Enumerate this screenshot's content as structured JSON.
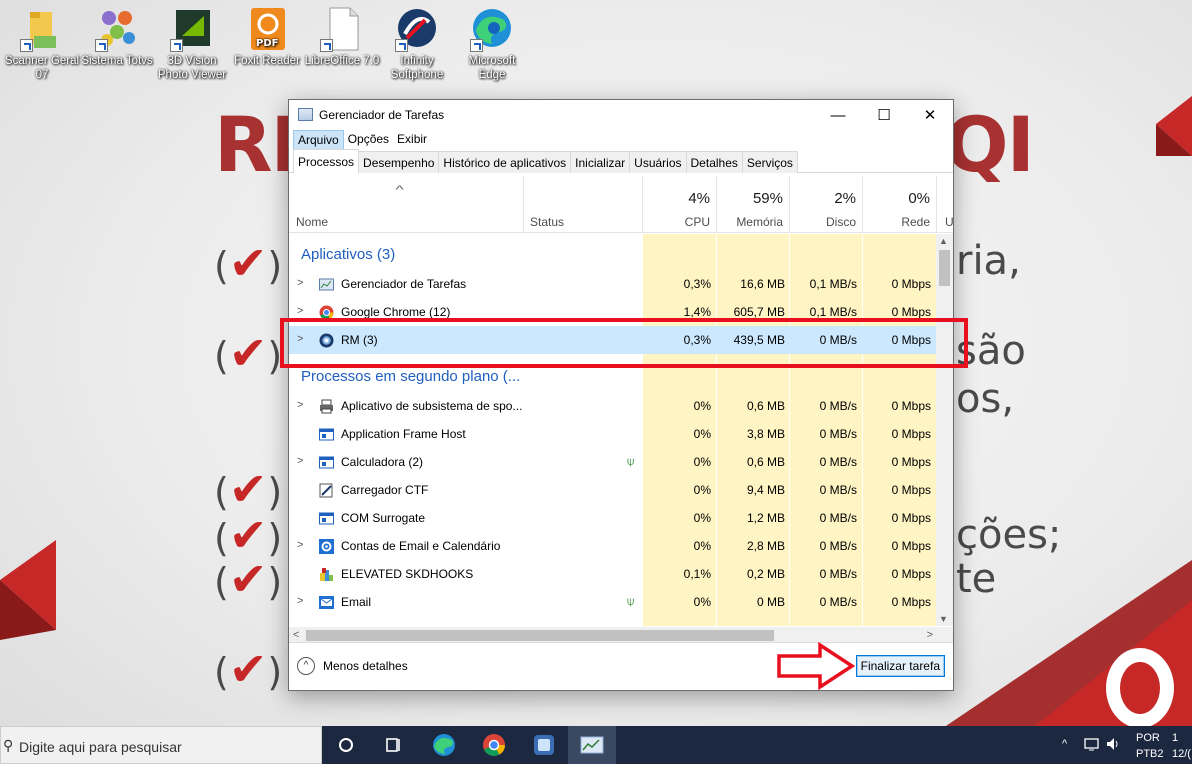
{
  "desktop": {
    "icons": [
      {
        "label": "Scanner Geral 07"
      },
      {
        "label": "Sistema Totvs"
      },
      {
        "label": "3D Vision Photo Viewer"
      },
      {
        "label": "Foxit Reader"
      },
      {
        "label": "LibreOffice 7.0"
      },
      {
        "label": "Infinity Softphone"
      },
      {
        "label": "Microsoft Edge"
      }
    ],
    "wallpaper": {
      "left_big": "RE",
      "right_big": "QI",
      "lines": [
        "ria,",
        "são",
        "os,",
        "ções;",
        "te"
      ],
      "check_marks": [
        "(✔)",
        "(✔)",
        "(✔)",
        "(✔)",
        "(✔)",
        "(✔)"
      ]
    }
  },
  "window": {
    "title": "Gerenciador de Tarefas",
    "controls": {
      "minimize": "—",
      "maximize": "☐",
      "close": "✕"
    },
    "menu": [
      {
        "label": "Arquivo",
        "active": true
      },
      {
        "label": "Opções"
      },
      {
        "label": "Exibir"
      }
    ],
    "tabs": [
      {
        "label": "Processos",
        "active": true
      },
      {
        "label": "Desempenho"
      },
      {
        "label": "Histórico de aplicativos"
      },
      {
        "label": "Inicializar"
      },
      {
        "label": "Usuários"
      },
      {
        "label": "Detalhes"
      },
      {
        "label": "Serviços"
      }
    ],
    "columns": {
      "name": "Nome",
      "status": "Status",
      "cpu": {
        "pct": "4%",
        "label": "CPU"
      },
      "memory": {
        "pct": "59%",
        "label": "Memória"
      },
      "disk": {
        "pct": "2%",
        "label": "Disco"
      },
      "network": {
        "pct": "0%",
        "label": "Rede"
      },
      "extra": "U"
    },
    "groups": {
      "apps": "Aplicativos (3)",
      "background": "Processos em segundo plano (..."
    },
    "apps": [
      {
        "name": "Gerenciador de Tarefas",
        "cpu": "0,3%",
        "memory": "16,6 MB",
        "disk": "0,1 MB/s",
        "network": "0 Mbps",
        "icon": "task-manager-icon"
      },
      {
        "name": "Google Chrome (12)",
        "cpu": "1,4%",
        "memory": "605,7 MB",
        "disk": "0,1 MB/s",
        "network": "0 Mbps",
        "icon": "chrome-icon"
      },
      {
        "name": "RM (3)",
        "cpu": "0,3%",
        "memory": "439,5 MB",
        "disk": "0 MB/s",
        "network": "0 Mbps",
        "icon": "rm-icon"
      }
    ],
    "background": [
      {
        "name": "Aplicativo de subsistema de spo...",
        "cpu": "0%",
        "memory": "0,6 MB",
        "disk": "0 MB/s",
        "network": "0 Mbps",
        "expand": true,
        "icon": "printer-icon"
      },
      {
        "name": "Application Frame Host",
        "cpu": "0%",
        "memory": "3,8 MB",
        "disk": "0 MB/s",
        "network": "0 Mbps",
        "expand": false,
        "icon": "app-frame-icon"
      },
      {
        "name": "Calculadora (2)",
        "cpu": "0%",
        "memory": "0,6 MB",
        "disk": "0 MB/s",
        "network": "0 Mbps",
        "expand": true,
        "icon": "calculator-icon",
        "leaf": true
      },
      {
        "name": "Carregador CTF",
        "cpu": "0%",
        "memory": "9,4 MB",
        "disk": "0 MB/s",
        "network": "0 Mbps",
        "expand": false,
        "icon": "ctf-loader-icon"
      },
      {
        "name": "COM Surrogate",
        "cpu": "0%",
        "memory": "1,2 MB",
        "disk": "0 MB/s",
        "network": "0 Mbps",
        "expand": false,
        "icon": "com-surrogate-icon"
      },
      {
        "name": "Contas de Email e Calendário",
        "cpu": "0%",
        "memory": "2,8 MB",
        "disk": "0 MB/s",
        "network": "0 Mbps",
        "expand": true,
        "icon": "gear-icon"
      },
      {
        "name": "ELEVATED SKDHOOKS",
        "cpu": "0,1%",
        "memory": "0,2 MB",
        "disk": "0 MB/s",
        "network": "0 Mbps",
        "expand": false,
        "icon": "skdhooks-icon"
      },
      {
        "name": "Email",
        "cpu": "0%",
        "memory": "0 MB",
        "disk": "0 MB/s",
        "network": "0 Mbps",
        "expand": true,
        "icon": "mail-icon",
        "leaf": true
      }
    ],
    "footer": {
      "less_details": "Menos detalhes",
      "end_task": "Finalizar tarefa"
    }
  },
  "taskbar": {
    "search_placeholder": "Digite aqui para pesquisar",
    "lang": "POR",
    "layout": "PTB2",
    "time": "1",
    "date": "12/("
  },
  "colors": {
    "highlight": "#e8101e",
    "selection": "#cce8ff",
    "heat": "#fff4c4",
    "accent": "#1f5fbf"
  }
}
